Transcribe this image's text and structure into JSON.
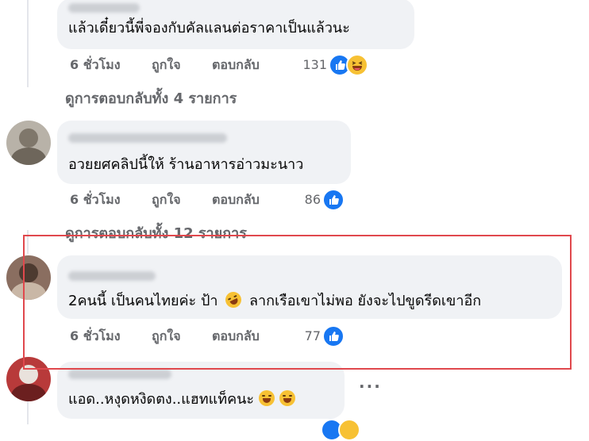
{
  "comments": [
    {
      "text": "แล้วเดี๋ยวนี้พี่จองกับคัลแลนต่อราคาเป็นแล้วนะ",
      "time": "6 ชั่วโมง",
      "like_label": "ถูกใจ",
      "reply_label": "ตอบกลับ",
      "reaction_count": "131",
      "reactions": [
        "like-icon",
        "haha-icon"
      ]
    },
    {
      "text": "อวยยศคลิปนี้ให้ ร้านอาหารอ่าวมะนาว",
      "time": "6 ชั่วโมง",
      "like_label": "ถูกใจ",
      "reply_label": "ตอบกลับ",
      "reaction_count": "86",
      "reactions": [
        "like-icon"
      ]
    },
    {
      "text_part1": "2คนนี้ เป็นคนไทยค่ะ ป้า",
      "text_part2": "ลากเรือเขาไม่พอ ยังจะไปขูดรีดเขาอีก",
      "time": "6 ชั่วโมง",
      "like_label": "ถูกใจ",
      "reply_label": "ตอบกลับ",
      "reaction_count": "77",
      "reactions": [
        "like-icon"
      ]
    },
    {
      "text": "แอด..หงุดหงิดตง..แฮทแท็คนะ",
      "more_label": "···"
    }
  ],
  "view_replies": [
    "ดูการตอบกลับทั้ง 4 รายการ",
    "ดูการตอบกลับทั้ง 12 รายการ"
  ],
  "colors": {
    "bubble": "#f0f2f5",
    "muted_text": "#65676b",
    "like_blue": "#1877f2",
    "haha_yellow": "#f7c134",
    "highlight_red": "#e0484d"
  }
}
